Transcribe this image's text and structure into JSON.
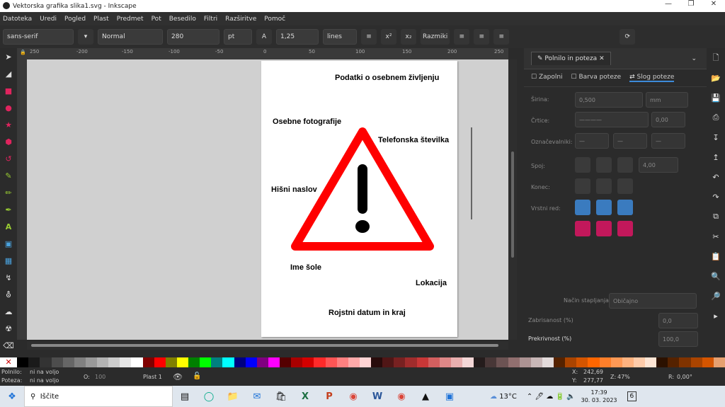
{
  "window": {
    "title": "Vektorska grafika slika1.svg - Inkscape"
  },
  "menu": [
    "Datoteka",
    "Uredi",
    "Pogled",
    "Plast",
    "Predmet",
    "Pot",
    "Besedilo",
    "Filtri",
    "Razširitve",
    "Pomoč"
  ],
  "toolbar": {
    "font_family": "sans-serif",
    "font_style": "Normal",
    "font_size": "280",
    "unit": "pt",
    "line_spacing": "1,25",
    "spacing_unit": "lines",
    "spacing_label": "Razmiki"
  },
  "ruler": {
    "ticks": [
      "250",
      "-200",
      "-150",
      "-100",
      "-50",
      "0",
      "50",
      "100",
      "150",
      "200",
      "250"
    ]
  },
  "canvas": {
    "labels": [
      "Podatki o osebnem življenju",
      "Osebne fotografije",
      "Telefonska številka",
      "Hišni naslov",
      "Ime šole",
      "Lokacija",
      "Rojstni datum in kraj"
    ]
  },
  "dock": {
    "tab_title": "Polnilo in poteza",
    "subtabs": [
      "Zapolni",
      "Barva poteze",
      "Slog poteze"
    ],
    "width_label": "Širina:",
    "width_value": "0,500",
    "width_unit": "mm",
    "dashes_label": "Črtice:",
    "dashes_value": "0,00",
    "markers_label": "Označevalniki:",
    "join_label": "Spoj:",
    "join_value": "4,00",
    "cap_label": "Konec:",
    "order_label": "Vrstni red:",
    "blend_label": "Način stapljanja:",
    "blend_value": "Običajno",
    "blur_label": "Zabrisanost (%)",
    "blur_value": "0,0",
    "opacity_label": "Prekrivnost (%)",
    "opacity_value": "100,0"
  },
  "status": {
    "fill_label": "Polnilo:",
    "fill_value": "ni na voljo",
    "stroke_label": "Poteza:",
    "stroke_value": "ni na voljo",
    "o_label": "O:",
    "o_value": "100",
    "layer": "Plast 1",
    "x_label": "X:",
    "x_value": "242,69",
    "y_label": "Y:",
    "y_value": "277,77",
    "zoom_label": "Z:",
    "zoom_value": "47%",
    "rot_label": "R:",
    "rot_value": "0,00°"
  },
  "taskbar": {
    "search_placeholder": "Iščite",
    "weather": "13°C",
    "time": "17:39",
    "date": "30. 03. 2023",
    "notif_count": "6"
  },
  "palette_colors": [
    "#000000",
    "#1a1a1a",
    "#333333",
    "#4d4d4d",
    "#666666",
    "#808080",
    "#999999",
    "#b3b3b3",
    "#cccccc",
    "#e6e6e6",
    "#ffffff",
    "#800000",
    "#ff0000",
    "#808000",
    "#ffff00",
    "#008000",
    "#00ff00",
    "#008080",
    "#00ffff",
    "#000080",
    "#0000ff",
    "#800080",
    "#ff00ff",
    "#550000",
    "#aa0000",
    "#d40000",
    "#ff2a2a",
    "#ff5555",
    "#ff8080",
    "#ffaaaa",
    "#ffd5d5",
    "#280b0b",
    "#501616",
    "#782121",
    "#a02c2c",
    "#c83737",
    "#d35f5f",
    "#de8787",
    "#e9afaf",
    "#f4d7d7",
    "#241c1c",
    "#483737",
    "#6c5353",
    "#916f6f",
    "#ac9393",
    "#c8b7b7",
    "#e3dbdb",
    "#552200",
    "#aa4400",
    "#d45500",
    "#ff6600",
    "#ff7f2a",
    "#ff9955",
    "#ffb380",
    "#ffccaa",
    "#ffe6d5",
    "#2b1100",
    "#552200",
    "#803300",
    "#aa4400",
    "#d45500",
    "#e6a070"
  ]
}
